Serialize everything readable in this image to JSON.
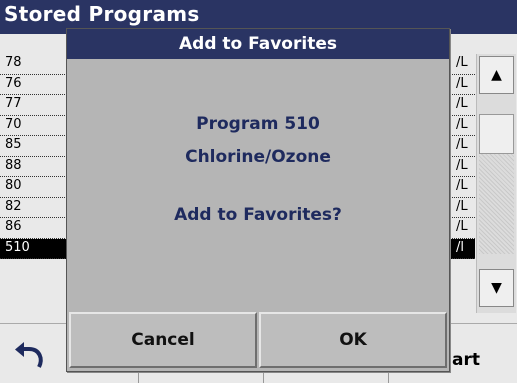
{
  "screen_title": "Stored Programs",
  "list": {
    "rows": [
      {
        "number": "78",
        "unit": "/L"
      },
      {
        "number": "76",
        "unit": "/L"
      },
      {
        "number": "77",
        "unit": "/L"
      },
      {
        "number": "70",
        "unit": "/L"
      },
      {
        "number": "85",
        "unit": "/L"
      },
      {
        "number": "88",
        "unit": "/L"
      },
      {
        "number": "80",
        "unit": "/L"
      },
      {
        "number": "82",
        "unit": "/L"
      },
      {
        "number": "86",
        "unit": "/L"
      },
      {
        "number": "510",
        "unit": "/l"
      }
    ],
    "selected_index": 9
  },
  "scrollbar": {
    "up_icon": "triangle-up",
    "down_icon": "triangle-down"
  },
  "bottom": {
    "back_icon": "back-arrow",
    "start_label": "art"
  },
  "dialog": {
    "title": "Add to Favorites",
    "program_line": "Program 510",
    "name_line": "Chlorine/Ozone",
    "question": "Add to Favorites?",
    "cancel_label": "Cancel",
    "ok_label": "OK"
  },
  "colors": {
    "title_bar": "#2a3463",
    "dialog_text": "#1e2a5e",
    "dialog_bg": "#b5b5b5"
  }
}
